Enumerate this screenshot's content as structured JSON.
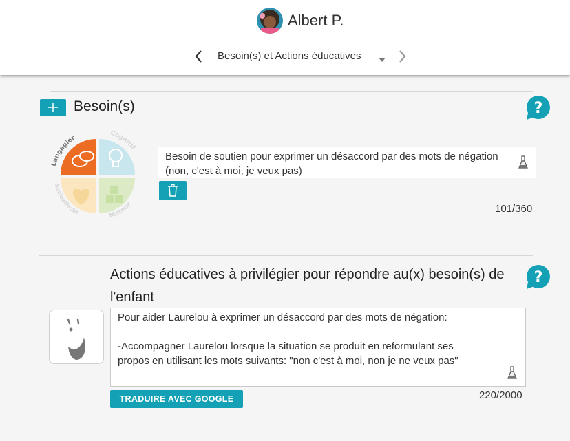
{
  "header": {
    "user_name": "Albert P.",
    "section_title": "Besoin(s) et Actions éducatives"
  },
  "needs": {
    "title": "Besoin(s)",
    "domains": [
      "Langagier",
      "Cognitif",
      "Socioaffectif",
      "Moteur"
    ],
    "text": "Besoin de soutien pour exprimer un désaccord par des mots de négation (non, c'est à moi, je veux pas)",
    "counter": "101/360"
  },
  "actions": {
    "title": "Actions éducatives à privilégier pour répondre au(x) besoin(s) de l'enfant",
    "lines": [
      "Pour aider Laurelou à exprimer un désaccord par des mots de négation:",
      "",
      "-Accompagner Laurelou lorsque la situation se produit en reformulant ses",
      "propos en utilisant les mots suivants: \"non c'est à moi, non je ne veux pas\""
    ],
    "counter": "220/2000",
    "translate_label": "TRADUIRE AVEC GOOGLE"
  },
  "colors": {
    "accent": "#14a1b5",
    "language_domain": "#ec6c23",
    "cognitive_domain": "#c8e6ee",
    "socioaffective_domain": "#fbe6c0",
    "motor_domain": "#dcebc6"
  },
  "icons": [
    "avatar",
    "chevron-left-icon",
    "chevron-right-icon",
    "caret-down-icon",
    "plus-icon",
    "help-icon",
    "trash-icon",
    "flask-icon",
    "child-face-icon"
  ]
}
